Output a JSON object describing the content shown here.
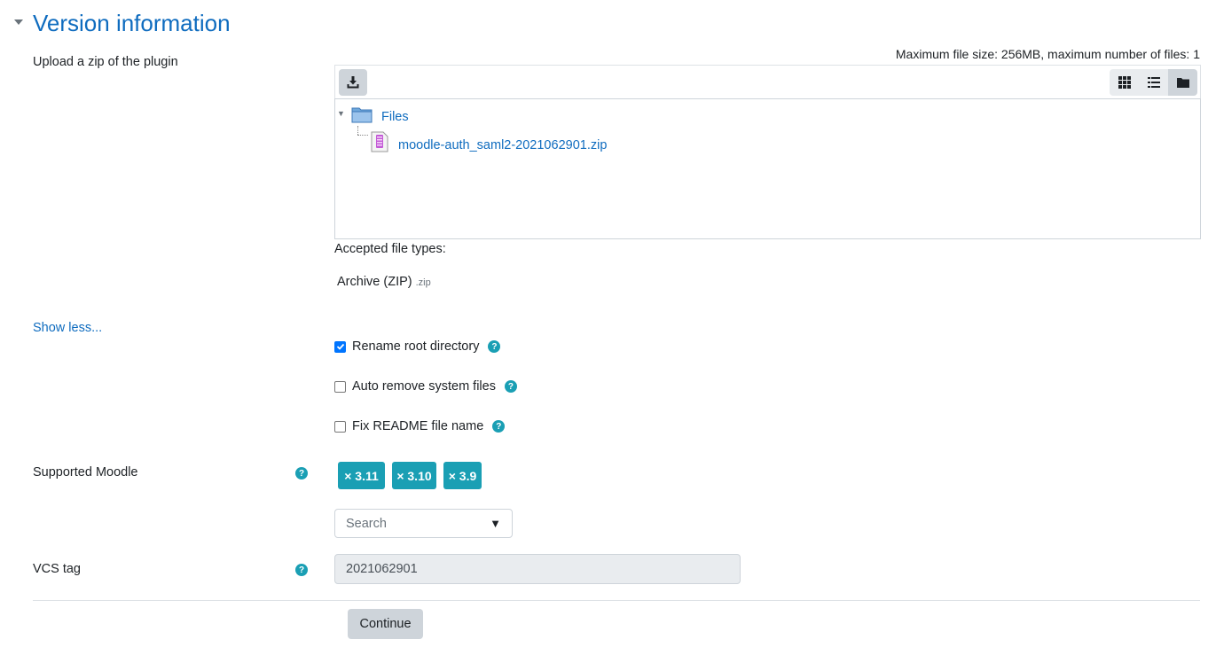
{
  "section": {
    "title": "Version information"
  },
  "upload": {
    "label": "Upload a zip of the plugin",
    "max_info": "Maximum file size: 256MB, maximum number of files: 1",
    "folder_name": "Files",
    "file_name": "moodle-auth_saml2-2021062901.zip",
    "accepted_label": "Accepted file types:",
    "accepted_type": "Archive (ZIP)",
    "accepted_ext": ".zip"
  },
  "show_less": "Show less...",
  "options": [
    {
      "label": "Rename root directory",
      "checked": true
    },
    {
      "label": "Auto remove system files",
      "checked": false
    },
    {
      "label": "Fix README file name",
      "checked": false
    }
  ],
  "supported": {
    "label": "Supported Moodle",
    "tags": [
      "× 3.11",
      "× 3.10",
      "× 3.9"
    ],
    "search_placeholder": "Search",
    "caret": "▼"
  },
  "vcs": {
    "label": "VCS tag",
    "value": "2021062901"
  },
  "continue_label": "Continue",
  "colors": {
    "link": "#0f6cbf",
    "tag": "#1a9fb4",
    "help": "#1a9fb4"
  }
}
